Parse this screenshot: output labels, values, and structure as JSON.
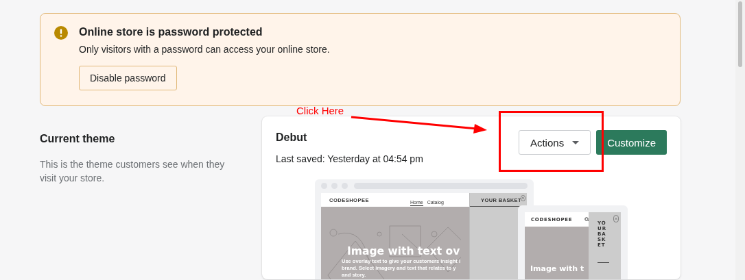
{
  "banner": {
    "title": "Online store is password protected",
    "message": "Only visitors with a password can access your online store.",
    "button": "Disable password"
  },
  "section": {
    "title": "Current theme",
    "description": "This is the theme customers see when they visit your store."
  },
  "theme": {
    "name": "Debut",
    "saved": "Last saved: Yesterday at 04:54 pm",
    "actions": "Actions",
    "customize": "Customize",
    "preview": {
      "desktop": {
        "logo": "CODESHOPEE",
        "nav": [
          {
            "label": "Home",
            "selected": true
          },
          {
            "label": "Catalog",
            "selected": false
          }
        ],
        "basket": "YOUR BASKET",
        "heading": "Image with text ov",
        "lines": [
          "Use overlay text to give your customers insight i",
          "brand. Select imagery and text that relates to y",
          "and story."
        ]
      },
      "mobile": {
        "logo": "CODESHOPEE",
        "basket": "YOUR BASKET",
        "heading": "Image with t"
      }
    }
  },
  "annotation": {
    "label": "Click Here"
  }
}
